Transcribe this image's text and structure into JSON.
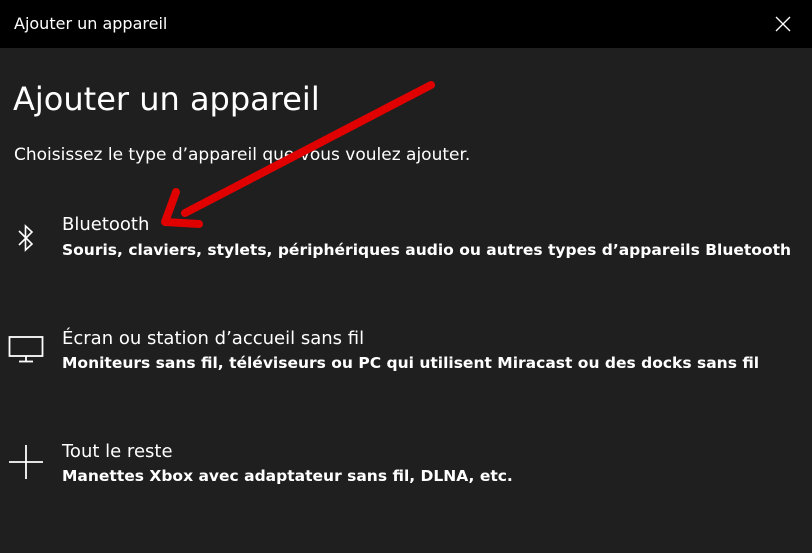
{
  "window": {
    "title": "Ajouter un appareil"
  },
  "main": {
    "heading": "Ajouter un appareil",
    "subtitle": "Choisissez le type d’appareil que vous voulez ajouter.",
    "options": [
      {
        "icon": "bluetooth-icon",
        "title": "Bluetooth",
        "description": "Souris, claviers, stylets, périphériques audio ou autres types d’appareils Bluetooth"
      },
      {
        "icon": "monitor-icon",
        "title": "Écran ou station d’accueil sans fil",
        "description": "Moniteurs sans fil, téléviseurs ou PC qui utilisent Miracast ou des docks sans fil"
      },
      {
        "icon": "plus-icon",
        "title": "Tout le reste",
        "description": "Manettes Xbox avec adaptateur sans fil, DLNA, etc."
      }
    ]
  },
  "colors": {
    "titlebar": "#000000",
    "background": "#1f1f1f",
    "text": "#ffffff",
    "annotation_arrow": "#e00000"
  }
}
